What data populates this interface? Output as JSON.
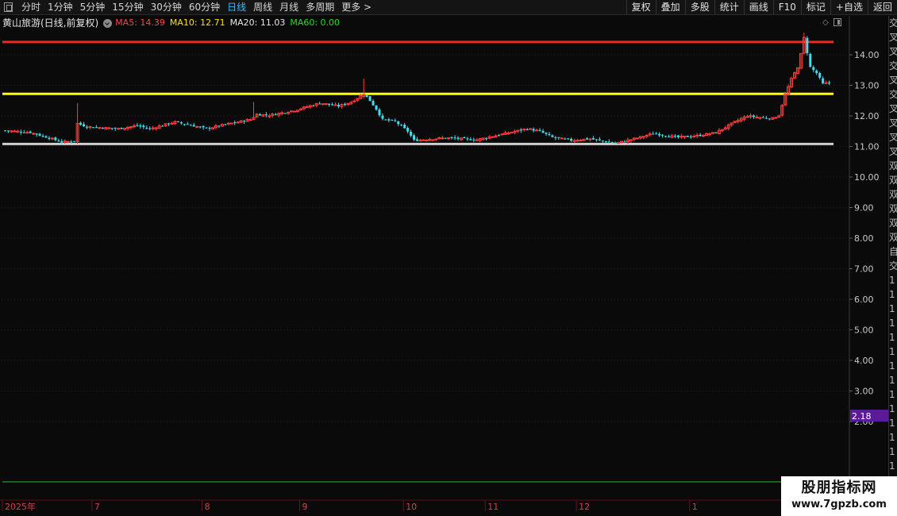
{
  "toolbar": {
    "periods": [
      "分时",
      "1分钟",
      "5分钟",
      "15分钟",
      "30分钟",
      "60分钟",
      "日线",
      "周线",
      "月线",
      "多周期",
      "更多 >"
    ],
    "active_period": "日线",
    "tools": [
      "复权",
      "叠加",
      "多股",
      "统计",
      "画线",
      "F10",
      "标记",
      "+自选",
      "返回"
    ]
  },
  "legend": {
    "title": "黄山旅游(日线,前复权)",
    "ma": [
      {
        "label": "MA5: 14.39",
        "color": "#ff4040"
      },
      {
        "label": "MA10: 12.71",
        "color": "#ffe000"
      },
      {
        "label": "MA20: 11.03",
        "color": "#e8e8e8"
      },
      {
        "label": "MA60: 0.00",
        "color": "#20e020"
      }
    ]
  },
  "chart_data": {
    "type": "candlestick",
    "title": "黄山旅游(日线,前复权)",
    "y_axis": {
      "ticks": [
        "14.00",
        "13.00",
        "12.00",
        "11.00",
        "10.00",
        "9.00",
        "8.00",
        "7.00",
        "6.00",
        "5.00",
        "4.00",
        "3.00",
        "2.00"
      ],
      "tick_values": [
        14,
        13,
        12,
        11,
        10,
        9,
        8,
        7,
        6,
        5,
        4,
        3,
        2
      ],
      "cursor_label": "2.18",
      "cursor_value": 2.18
    },
    "x_axis": {
      "labels": [
        "2025年",
        "7",
        "8",
        "9",
        "10",
        "11",
        "12",
        "1"
      ],
      "label_bar_index": [
        0,
        28,
        63,
        94,
        127,
        153,
        182,
        218
      ]
    },
    "horizontal_lines": [
      {
        "value": 14.42,
        "color": "#ff2020"
      },
      {
        "value": 12.72,
        "color": "#ffff00"
      },
      {
        "value": 11.08,
        "color": "#d0d0d0"
      }
    ],
    "close_path": [
      [
        0,
        11.52
      ],
      [
        8,
        11.46
      ],
      [
        14,
        11.28
      ],
      [
        18,
        11.14
      ],
      [
        22,
        11.18
      ],
      [
        23,
        11.75
      ],
      [
        26,
        11.65
      ],
      [
        30,
        11.62
      ],
      [
        36,
        11.58
      ],
      [
        42,
        11.68
      ],
      [
        46,
        11.58
      ],
      [
        54,
        11.8
      ],
      [
        58,
        11.72
      ],
      [
        64,
        11.58
      ],
      [
        70,
        11.72
      ],
      [
        78,
        11.88
      ],
      [
        80,
        12.05
      ],
      [
        84,
        12.02
      ],
      [
        92,
        12.18
      ],
      [
        100,
        12.42
      ],
      [
        106,
        12.32
      ],
      [
        110,
        12.45
      ],
      [
        114,
        12.72
      ],
      [
        116,
        12.5
      ],
      [
        118,
        12.22
      ],
      [
        120,
        11.88
      ],
      [
        124,
        11.82
      ],
      [
        128,
        11.5
      ],
      [
        130,
        11.2
      ],
      [
        140,
        11.28
      ],
      [
        150,
        11.22
      ],
      [
        158,
        11.4
      ],
      [
        166,
        11.58
      ],
      [
        170,
        11.5
      ],
      [
        174,
        11.3
      ],
      [
        180,
        11.2
      ],
      [
        186,
        11.25
      ],
      [
        194,
        11.1
      ],
      [
        200,
        11.25
      ],
      [
        206,
        11.42
      ],
      [
        214,
        11.3
      ],
      [
        220,
        11.35
      ],
      [
        226,
        11.45
      ],
      [
        232,
        11.8
      ],
      [
        236,
        12.0
      ],
      [
        240,
        11.95
      ],
      [
        244,
        11.92
      ],
      [
        246,
        12.02
      ],
      [
        248,
        12.7
      ],
      [
        250,
        13.2
      ],
      [
        252,
        13.6
      ],
      [
        253,
        14.02
      ],
      [
        254,
        14.55
      ],
      [
        256,
        13.6
      ],
      [
        258,
        13.4
      ],
      [
        260,
        13.05
      ],
      [
        262,
        13.08
      ]
    ],
    "spikes": [
      {
        "bar": 23,
        "high": 12.42
      },
      {
        "bar": 79,
        "high": 12.46
      },
      {
        "bar": 114,
        "high": 13.22
      },
      {
        "bar": 254,
        "high": 14.72
      }
    ]
  },
  "right_panel": {
    "chars": [
      "交",
      "叉",
      "叉",
      "交",
      "叉",
      "交",
      "叉",
      "叉",
      "叉",
      "叉",
      "双",
      "双",
      "双",
      "双",
      "双",
      "双",
      "自",
      "交",
      "1",
      "1",
      "1",
      "1",
      "1",
      "1",
      "1",
      "1",
      "1",
      "1",
      "1",
      "1",
      "1",
      "1",
      "1",
      "1"
    ]
  },
  "watermark": {
    "line1": "股朋指标网",
    "line2": "www.7gpzb.com"
  }
}
